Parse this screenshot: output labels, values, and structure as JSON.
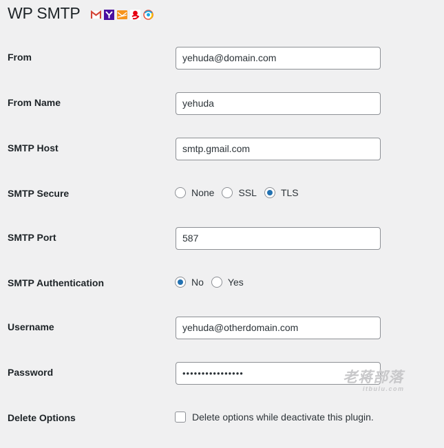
{
  "header": {
    "title": "WP SMTP",
    "provider_icons": [
      "gmail-icon",
      "yahoo-icon",
      "hotmail-icon",
      "163-mail-icon",
      "qq-mail-icon"
    ]
  },
  "fields": {
    "from": {
      "label": "From",
      "value": "yehuda@domain.com"
    },
    "from_name": {
      "label": "From Name",
      "value": "yehuda"
    },
    "smtp_host": {
      "label": "SMTP Host",
      "value": "smtp.gmail.com"
    },
    "smtp_secure": {
      "label": "SMTP Secure",
      "options": [
        {
          "label": "None",
          "checked": false
        },
        {
          "label": "SSL",
          "checked": false
        },
        {
          "label": "TLS",
          "checked": true
        }
      ]
    },
    "smtp_port": {
      "label": "SMTP Port",
      "value": "587"
    },
    "smtp_auth": {
      "label": "SMTP Authentication",
      "options": [
        {
          "label": "No",
          "checked": true
        },
        {
          "label": "Yes",
          "checked": false
        }
      ]
    },
    "username": {
      "label": "Username",
      "value": "yehuda@otherdomain.com"
    },
    "password": {
      "label": "Password",
      "value": "••••••••••••••••"
    },
    "delete_options": {
      "label": "Delete Options",
      "checkbox_label": "Delete options while deactivate this plugin.",
      "checked": false
    }
  },
  "watermark": {
    "line1": "老蒋部落",
    "line2": "itbulu.com"
  },
  "colors": {
    "accent": "#2271b1",
    "background": "#f0f0f1",
    "border": "#8c8f94"
  }
}
